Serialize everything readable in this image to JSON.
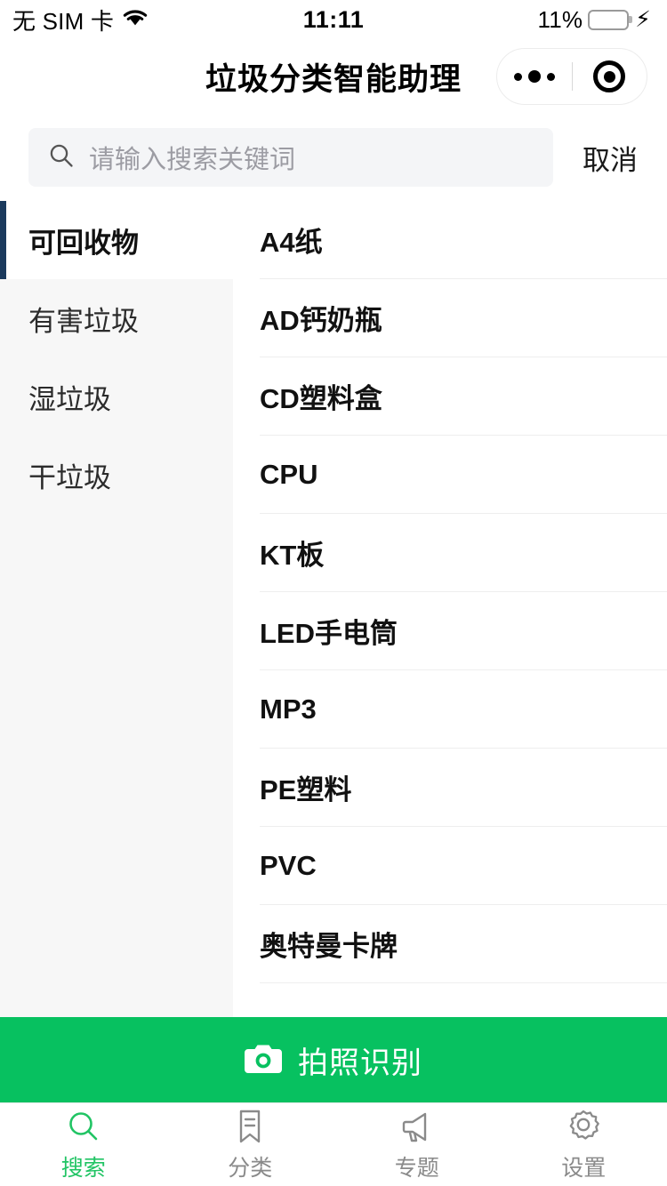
{
  "statusbar": {
    "carrier": "无 SIM 卡",
    "wifi_icon": "wifi-icon",
    "time": "11:11",
    "battery_percent": "11%",
    "battery_level": 11,
    "battery_color": "#fb3b30",
    "charging_icon": "lightning-bolt-icon"
  },
  "navbar": {
    "title": "垃圾分类智能助理",
    "capsule": {
      "more_icon": "more-dots-icon",
      "target_icon": "target-circle-icon"
    }
  },
  "search": {
    "icon": "search-icon",
    "placeholder": "请输入搜索关键词",
    "value": "",
    "cancel_label": "取消"
  },
  "categories": [
    {
      "label": "可回收物",
      "active": true
    },
    {
      "label": "有害垃圾",
      "active": false
    },
    {
      "label": "湿垃圾",
      "active": false
    },
    {
      "label": "干垃圾",
      "active": false
    }
  ],
  "items": [
    {
      "label": "A4纸"
    },
    {
      "label": "AD钙奶瓶"
    },
    {
      "label": "CD塑料盒"
    },
    {
      "label": "CPU"
    },
    {
      "label": "KT板"
    },
    {
      "label": "LED手电筒"
    },
    {
      "label": "MP3"
    },
    {
      "label": "PE塑料"
    },
    {
      "label": "PVC"
    },
    {
      "label": "奥特曼卡牌"
    }
  ],
  "cta": {
    "icon": "camera-icon",
    "label": "拍照识别",
    "color": "#07c160"
  },
  "tabbar": {
    "active_color": "#21c464",
    "inactive_color": "#8a8a8a",
    "tabs": [
      {
        "label": "搜索",
        "icon": "search-icon",
        "active": true
      },
      {
        "label": "分类",
        "icon": "bookmark-list-icon",
        "active": false
      },
      {
        "label": "专题",
        "icon": "megaphone-icon",
        "active": false
      },
      {
        "label": "设置",
        "icon": "gear-icon",
        "active": false
      }
    ]
  },
  "theme": {
    "accent_navy": "#1b3a5d",
    "sidebar_bg": "#f7f7f7",
    "search_bg": "#f4f5f7"
  }
}
